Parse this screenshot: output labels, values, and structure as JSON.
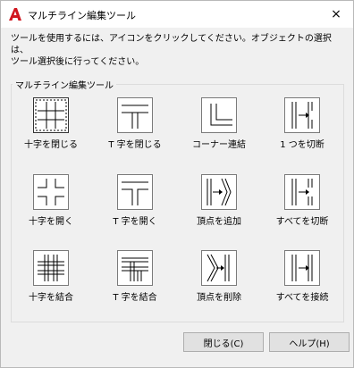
{
  "window": {
    "title": "マルチライン編集ツール",
    "close_icon": "×"
  },
  "description": {
    "line1": "ツールを使用するには、アイコンをクリックしてください。オブジェクトの選択は、",
    "line2": "ツール選択後に行ってください。"
  },
  "group": {
    "title": "マルチライン編集ツール"
  },
  "tools": [
    {
      "label": "十字を閉じる"
    },
    {
      "label": "T 字を閉じる"
    },
    {
      "label": "コーナー連結"
    },
    {
      "label": "1 つを切断"
    },
    {
      "label": "十字を開く"
    },
    {
      "label": "T 字を開く"
    },
    {
      "label": "頂点を追加"
    },
    {
      "label": "すべてを切断"
    },
    {
      "label": "十字を結合"
    },
    {
      "label": "T 字を結合"
    },
    {
      "label": "頂点を削除"
    },
    {
      "label": "すべてを接続"
    }
  ],
  "buttons": {
    "close": "閉じる(C)",
    "help": "ヘルプ(H)"
  },
  "colors": {
    "brand_red": "#d0161f"
  }
}
